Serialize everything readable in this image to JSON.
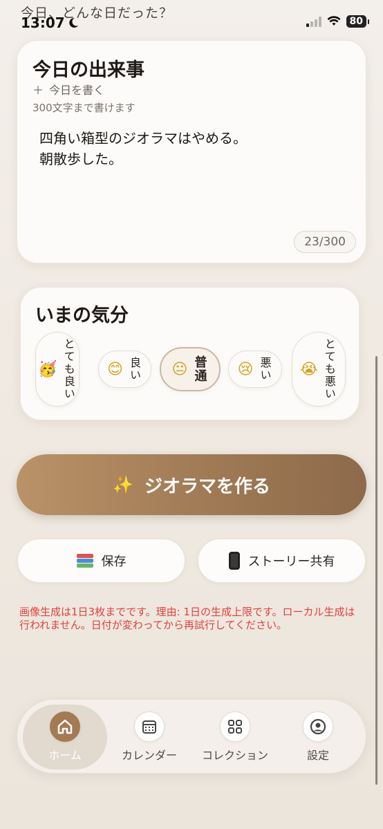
{
  "status_bar": {
    "faded_heading": "今日、どんな日だった？",
    "time": "13:07",
    "battery": "80"
  },
  "today_card": {
    "title": "今日の出来事",
    "add_label": "今日を書く",
    "limit_note": "300文字まで書けます",
    "entry_text": "四角い箱型のジオラマはやめる。\n朝散歩した。",
    "counter": "23/300"
  },
  "mood_card": {
    "title": "いまの気分",
    "selected": "普通",
    "options": [
      {
        "label": "とても良い",
        "icon": "party-face-icon"
      },
      {
        "label": "良い",
        "icon": "smiling-face-icon"
      },
      {
        "label": "普通",
        "icon": "neutral-face-icon"
      },
      {
        "label": "悪い",
        "icon": "sad-face-icon"
      },
      {
        "label": "とても悪い",
        "icon": "crying-face-icon"
      }
    ]
  },
  "actions": {
    "make_label": "ジオラマを作る",
    "save_label": "保存",
    "share_label": "ストーリー共有"
  },
  "error_message": "画像生成は1日3枚までです。理由: 1日の生成上限です。ローカル生成は行われません。日付が変わってから再試行してください。",
  "tabbar": {
    "active": "ホーム",
    "tabs": [
      {
        "label": "ホーム",
        "icon": "home-icon"
      },
      {
        "label": "カレンダー",
        "icon": "calendar-icon"
      },
      {
        "label": "コレクション",
        "icon": "grid-icon"
      },
      {
        "label": "設定",
        "icon": "profile-icon"
      }
    ]
  },
  "colors": {
    "accent": "#a47a54",
    "error": "#e0413c",
    "background": "#f0ebe4"
  }
}
